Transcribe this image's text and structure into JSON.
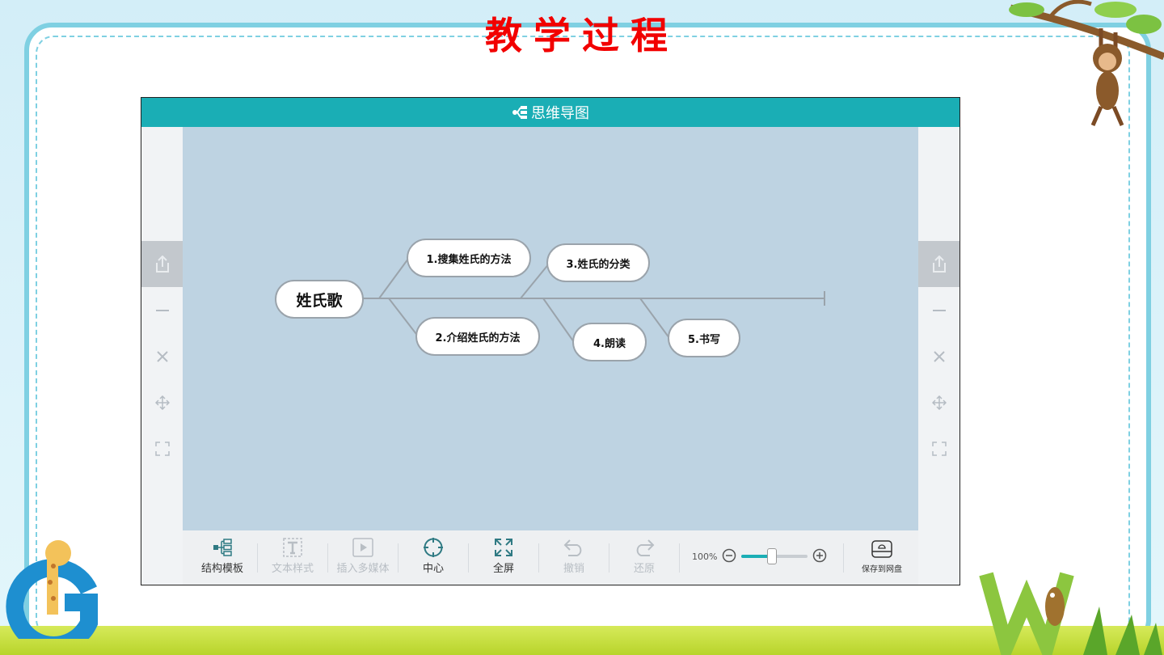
{
  "slide": {
    "title": "教学过程"
  },
  "app": {
    "title": "思维导图",
    "side_icons": [
      "share-icon",
      "collapse-icon",
      "delete-icon",
      "move-icon",
      "fit-icon"
    ]
  },
  "mindmap": {
    "root": "姓氏歌",
    "branches": [
      "1.搜集姓氏的方法",
      "2.介绍姓氏的方法",
      "3.姓氏的分类",
      "4.朗读",
      "5.书写"
    ]
  },
  "toolbar": {
    "structure_template": "结构模板",
    "text_style": "文本样式",
    "insert_media": "插入多媒体",
    "center": "中心",
    "fullscreen": "全屏",
    "undo": "撤销",
    "redo": "还原",
    "zoom_label": "100%",
    "zoom_level": 0.45,
    "save_to_disk": "保存到网盘"
  },
  "colors": {
    "accent": "#1aaeb5",
    "canvas": "#bed3e2",
    "title_red": "#f20000",
    "frame": "#7fd0e2"
  }
}
